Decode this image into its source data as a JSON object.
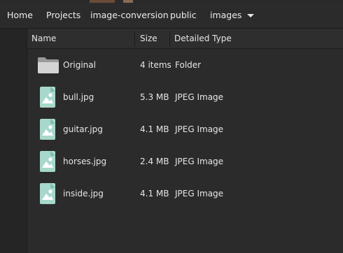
{
  "pathbar": {
    "crumbs": [
      "Home",
      "Projects",
      "image-conversion",
      "public",
      "images"
    ],
    "dropdown_icon": "chevron-down-icon"
  },
  "columns": {
    "name": "Name",
    "size": "Size",
    "type": "Detailed Type"
  },
  "files": [
    {
      "name": "Original",
      "size": "4 items",
      "type": "Folder",
      "icon": "folder-icon"
    },
    {
      "name": "bull.jpg",
      "size": "5.3 MB",
      "type": "JPEG Image",
      "icon": "image-file-icon"
    },
    {
      "name": "guitar.jpg",
      "size": "4.1 MB",
      "type": "JPEG Image",
      "icon": "image-file-icon"
    },
    {
      "name": "horses.jpg",
      "size": "2.4 MB",
      "type": "JPEG Image",
      "icon": "image-file-icon"
    },
    {
      "name": "inside.jpg",
      "size": "4.1 MB",
      "type": "JPEG Image",
      "icon": "image-file-icon"
    }
  ],
  "colors": {
    "background": "#242424",
    "folder": "#c8c8c8",
    "image_icon": "#9fd3c7"
  }
}
